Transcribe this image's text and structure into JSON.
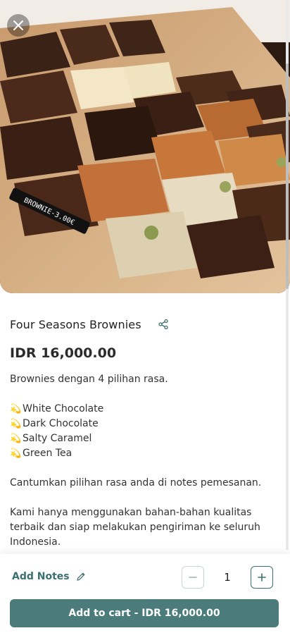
{
  "product": {
    "image_icon": "product-photo-brownies",
    "title": "Four Seasons Brownies",
    "price": "IDR 16,000.00",
    "description_intro": "Brownies dengan 4 pilihan rasa.",
    "flavor_emoji": "💫",
    "flavors": [
      "White Chocolate",
      "Dark Chocolate",
      "Salty Caramel",
      "Green Tea"
    ],
    "description_note": "Cantumkan pilihan rasa anda di notes pemesanan.",
    "description_quality": "Kami hanya menggunakan bahan-bahan kualitas terbaik dan siap melakukan pengiriman ke seluruh Indonesia.",
    "price_tag_text": "BROWNIE-3.00€"
  },
  "actions": {
    "add_notes_label": "Add Notes",
    "quantity": "1",
    "add_to_cart_label": "Add to cart - IDR 16,000.00"
  },
  "colors": {
    "accent": "#4b7c7b",
    "accent_text": "#3d6f6e",
    "price_text": "#2b2b2b"
  }
}
